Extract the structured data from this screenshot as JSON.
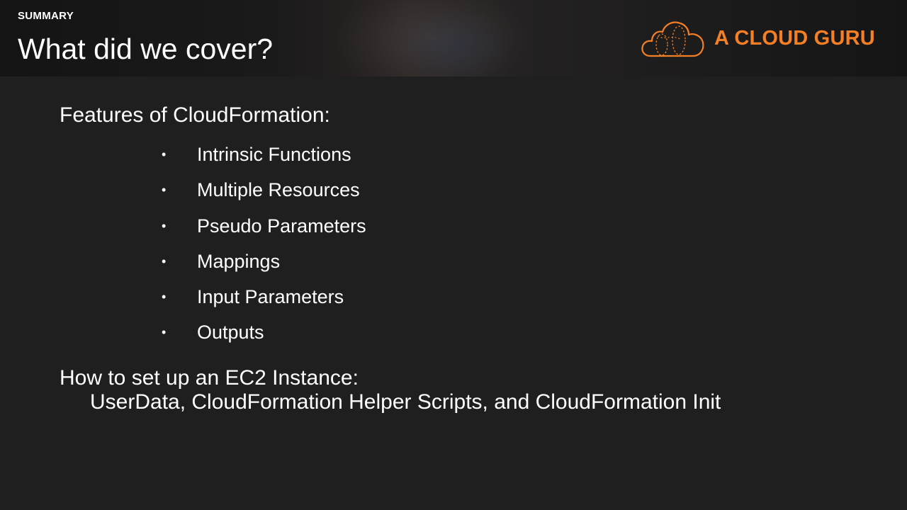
{
  "header": {
    "eyebrow": "SUMMARY",
    "title": "What did we cover?",
    "logo_text": "A CLOUD GURU"
  },
  "features": {
    "heading": "Features of CloudFormation:",
    "items": [
      {
        "label": "Intrinsic Functions"
      },
      {
        "label": "Multiple Resources"
      },
      {
        "label": "Pseudo Parameters"
      },
      {
        "label": "Mappings"
      },
      {
        "label": "Input Parameters"
      },
      {
        "label": "Outputs"
      }
    ]
  },
  "ec2": {
    "heading": "How to set up an EC2 Instance:",
    "detail": "UserData, CloudFormation Helper Scripts, and CloudFormation Init"
  },
  "colors": {
    "background": "#1f1f1f",
    "brand_orange": "#f47f24",
    "text": "#ffffff"
  },
  "icons": {
    "bullet": "•",
    "logo": "cloud-logo-icon"
  }
}
